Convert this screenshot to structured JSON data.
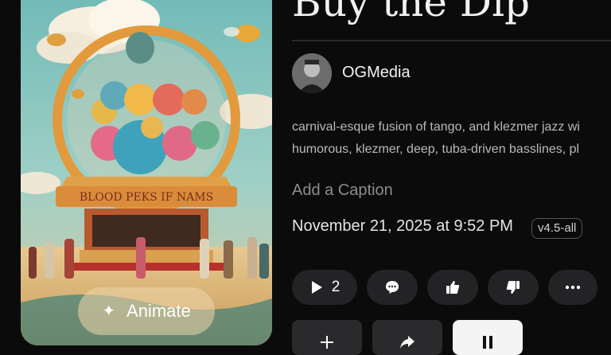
{
  "song": {
    "title": "Buy the Dip",
    "author": "OGMedia",
    "styles_line1": "carnival-esque fusion of tango, and klezmer jazz wi",
    "styles_line2": "humorous, klezmer, deep, tuba-driven basslines, pl",
    "caption_placeholder": "Add a Caption",
    "date": "November 21, 2025 at 9:52 PM",
    "model_badge": "v4.5-all"
  },
  "cover": {
    "animate_label": "Animate",
    "sign_text": "BLOOD  PEKS  IF  NAMS"
  },
  "actions": {
    "play_count": "2",
    "icons": [
      "play-icon",
      "comment-icon",
      "thumbs-up-icon",
      "thumbs-down-icon",
      "more-icon"
    ],
    "bottom_icons": [
      "add-icon",
      "share-icon",
      "pause-icon"
    ]
  },
  "colors": {
    "background": "#0b0b0c",
    "pill": "#232325",
    "muted_text": "#8d8d90",
    "animate_button": "#eed6aa"
  }
}
